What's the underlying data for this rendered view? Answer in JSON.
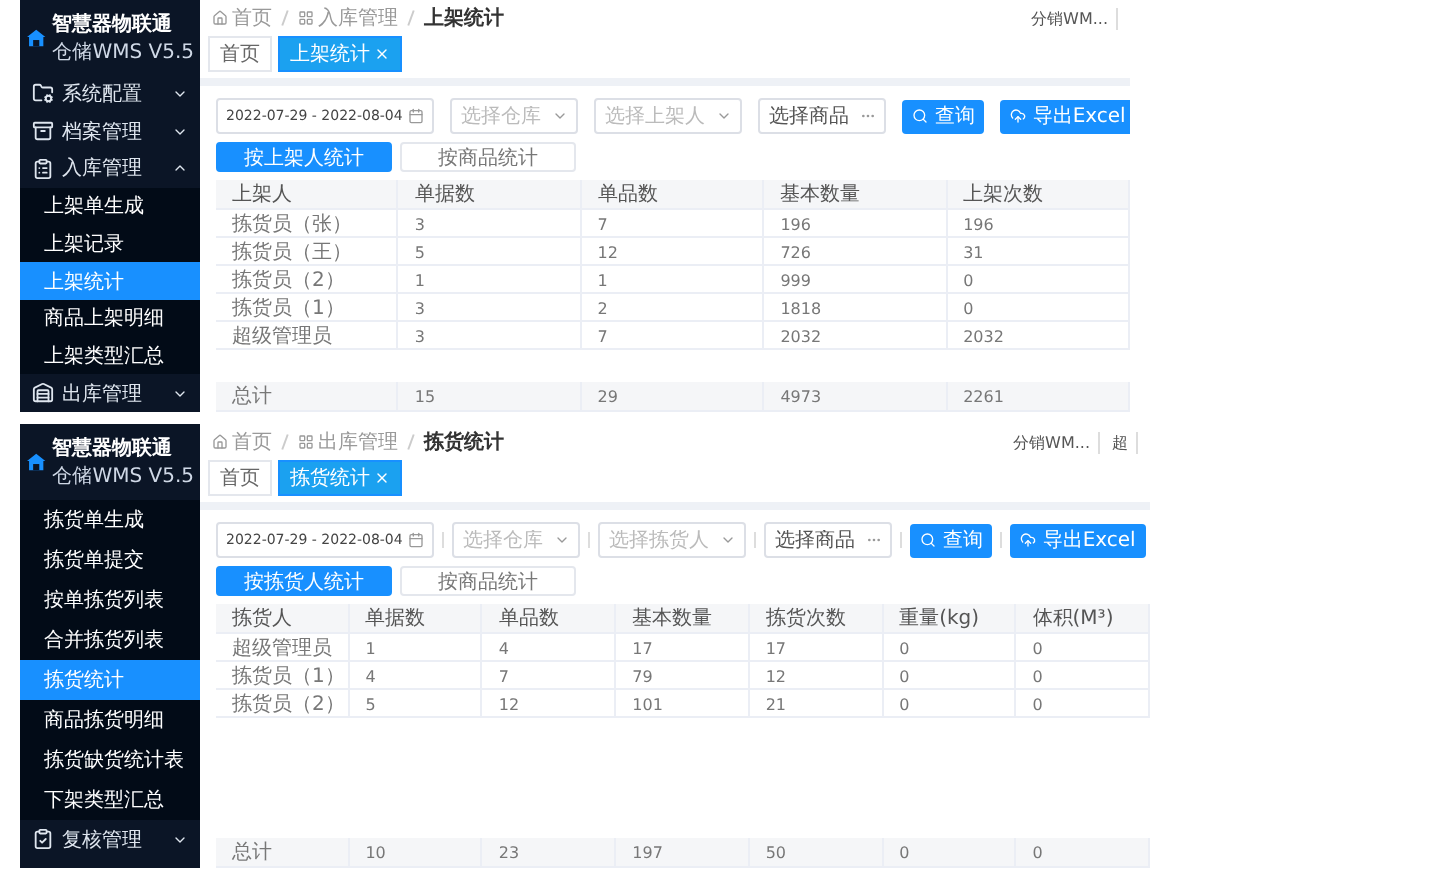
{
  "screens": [
    {
      "logo": {
        "title": "智慧器物联通",
        "subtitle": "仓储WMS V5.5"
      },
      "sidebar": [
        {
          "kind": "group",
          "label": "系统配置",
          "expanded": false
        },
        {
          "kind": "group",
          "label": "档案管理",
          "expanded": false
        },
        {
          "kind": "group",
          "label": "入库管理",
          "expanded": true,
          "children": [
            {
              "kind": "link",
              "label": "上架单生成",
              "selected": false
            },
            {
              "kind": "link",
              "label": "上架记录",
              "selected": false
            },
            {
              "kind": "link",
              "label": "上架统计",
              "selected": true
            },
            {
              "kind": "link",
              "label": "商品上架明细",
              "selected": false
            },
            {
              "kind": "link",
              "label": "上架类型汇总",
              "selected": false
            }
          ]
        },
        {
          "kind": "group",
          "label": "出库管理",
          "expanded": false
        }
      ],
      "breadcrumb": [
        "首页",
        "入库管理",
        "上架统计"
      ],
      "header_right": [
        "分销WM..."
      ],
      "tabs": [
        {
          "label": "首页",
          "selected": false
        },
        {
          "label": "上架统计",
          "selected": true
        }
      ],
      "filters": [
        {
          "kind": "date",
          "value": "2022-07-29 - 2022-08-04"
        },
        {
          "kind": "select",
          "placeholder": "选择仓库"
        },
        {
          "kind": "select",
          "placeholder": "选择上架人"
        },
        {
          "kind": "picker",
          "placeholder": "选择商品"
        }
      ],
      "buttons": [
        {
          "kind": "search",
          "label": "查询"
        },
        {
          "kind": "export",
          "label": "导出Excel"
        }
      ],
      "modes": [
        {
          "label": "按上架人统计",
          "selected": true
        },
        {
          "label": "按商品统计",
          "selected": false
        }
      ],
      "table": {
        "columns": [
          "上架人",
          "单据数",
          "单品数",
          "基本数量",
          "上架次数"
        ],
        "rows": [
          [
            "拣货员（张）",
            "3",
            "7",
            "196",
            "196"
          ],
          [
            "拣货员（王）",
            "5",
            "12",
            "726",
            "31"
          ],
          [
            "拣货员（2）",
            "1",
            "1",
            "999",
            "0"
          ],
          [
            "拣货员（1）",
            "3",
            "2",
            "1818",
            "0"
          ],
          [
            "超级管理员",
            "3",
            "7",
            "2032",
            "2032"
          ]
        ],
        "totals": [
          "总计",
          "15",
          "29",
          "4973",
          "2261"
        ]
      }
    },
    {
      "logo": {
        "title": "智慧器物联通",
        "subtitle": "仓储WMS V5.5"
      },
      "sidebar": [
        {
          "kind": "link",
          "label": "拣货单生成",
          "selected": false
        },
        {
          "kind": "link",
          "label": "拣货单提交",
          "selected": false
        },
        {
          "kind": "link",
          "label": "按单拣货列表",
          "selected": false
        },
        {
          "kind": "link",
          "label": "合并拣货列表",
          "selected": false
        },
        {
          "kind": "link",
          "label": "拣货统计",
          "selected": true
        },
        {
          "kind": "link",
          "label": "商品拣货明细",
          "selected": false
        },
        {
          "kind": "link",
          "label": "拣货缺货统计表",
          "selected": false
        },
        {
          "kind": "link",
          "label": "下架类型汇总",
          "selected": false
        },
        {
          "kind": "group",
          "label": "复核管理",
          "expanded": false
        }
      ],
      "breadcrumb": [
        "首页",
        "出库管理",
        "拣货统计"
      ],
      "header_right": [
        "分销WM...",
        "超"
      ],
      "tabs": [
        {
          "label": "首页",
          "selected": false
        },
        {
          "label": "拣货统计",
          "selected": true
        }
      ],
      "filters": [
        {
          "kind": "date",
          "value": "2022-07-29 - 2022-08-04"
        },
        {
          "kind": "select",
          "placeholder": "选择仓库"
        },
        {
          "kind": "select",
          "placeholder": "选择拣货人"
        },
        {
          "kind": "picker",
          "placeholder": "选择商品"
        }
      ],
      "buttons": [
        {
          "kind": "search",
          "label": "查询"
        },
        {
          "kind": "export",
          "label": "导出Excel"
        }
      ],
      "modes": [
        {
          "label": "按拣货人统计",
          "selected": true
        },
        {
          "label": "按商品统计",
          "selected": false
        }
      ],
      "table": {
        "columns": [
          "拣货人",
          "单据数",
          "单品数",
          "基本数量",
          "拣货次数",
          "重量(kg)",
          "体积(M³)"
        ],
        "rows": [
          [
            "超级管理员",
            "1",
            "4",
            "17",
            "17",
            "0",
            "0"
          ],
          [
            "拣货员（1）",
            "4",
            "7",
            "79",
            "12",
            "0",
            "0"
          ],
          [
            "拣货员（2）",
            "5",
            "12",
            "101",
            "21",
            "0",
            "0"
          ]
        ],
        "totals": [
          "总计",
          "10",
          "23",
          "197",
          "50",
          "0",
          "0"
        ]
      }
    }
  ]
}
